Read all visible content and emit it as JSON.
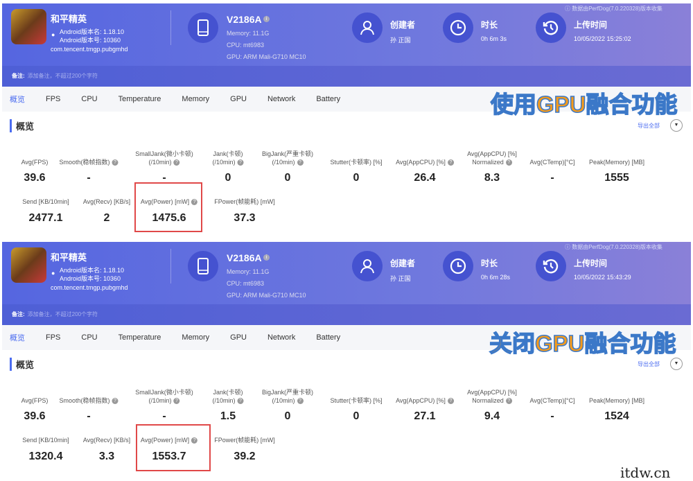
{
  "panels": [
    {
      "app": {
        "name": "和平精英",
        "version_name": "Android版本名: 1.18.10",
        "version_code": "Android版本号: 10360",
        "package": "com.tencent.tmgp.pubgmhd"
      },
      "device": {
        "model": "V2186A",
        "memory": "Memory: 11.1G",
        "cpu": "CPU: mt6983",
        "gpu": "GPU: ARM Mali-G710 MC10"
      },
      "creator": {
        "label": "创建者",
        "value": "孙 正国"
      },
      "duration": {
        "label": "时长",
        "value": "0h 6m 3s"
      },
      "upload": {
        "label": "上传时间",
        "value": "10/05/2022 15:25:02"
      },
      "source_note": "ⓘ 数据由PerfDog(7.0.220328)版本收集",
      "remark": {
        "label": "备注:",
        "placeholder": "添加备注，不超过200个字符"
      },
      "tabs": [
        "概览",
        "FPS",
        "CPU",
        "Temperature",
        "Memory",
        "GPU",
        "Network",
        "Battery"
      ],
      "section_title": "概览",
      "export_label": "导出全部",
      "overlay_caption": "使用GPU融合功能",
      "metrics_row1": [
        {
          "label": "Avg(FPS)",
          "value": "39.6"
        },
        {
          "label": "Smooth(稳帧指数)",
          "value": "-",
          "help": true
        },
        {
          "label": "SmallJank(微小卡顿)\n(/10min)",
          "value": "-",
          "help": true
        },
        {
          "label": "Jank(卡顿)\n(/10min)",
          "value": "0",
          "help": true
        },
        {
          "label": "BigJank(严重卡顿)\n(/10min)",
          "value": "0",
          "help": true
        },
        {
          "label": "Stutter(卡顿率) [%]",
          "value": "0"
        },
        {
          "label": "Avg(AppCPU) [%]",
          "value": "26.4",
          "help": true
        },
        {
          "label": "Avg(AppCPU) [%]\nNormalized",
          "value": "8.3",
          "help": true
        },
        {
          "label": "Avg(CTemp)[°C]",
          "value": "-"
        },
        {
          "label": "Peak(Memory) [MB]",
          "value": "1555"
        }
      ],
      "metrics_row2": [
        {
          "label": "Send [KB/10min]",
          "value": "2477.1"
        },
        {
          "label": "Avg(Recv) [KB/s]",
          "value": "2"
        },
        {
          "label": "Avg(Power) [mW]",
          "value": "1475.6",
          "help": true,
          "highlighted": true
        },
        {
          "label": "FPower(帧能耗) [mW]",
          "value": "37.3"
        }
      ]
    },
    {
      "app": {
        "name": "和平精英",
        "version_name": "Android版本名: 1.18.10",
        "version_code": "Android版本号: 10360",
        "package": "com.tencent.tmgp.pubgmhd"
      },
      "device": {
        "model": "V2186A",
        "memory": "Memory: 11.1G",
        "cpu": "CPU: mt6983",
        "gpu": "GPU: ARM Mali-G710 MC10"
      },
      "creator": {
        "label": "创建者",
        "value": "孙 正国"
      },
      "duration": {
        "label": "时长",
        "value": "0h 6m 28s"
      },
      "upload": {
        "label": "上传时间",
        "value": "10/05/2022 15:43:29"
      },
      "source_note": "ⓘ 数据由PerfDog(7.0.220328)版本收集",
      "remark": {
        "label": "备注:",
        "placeholder": "添加备注，不超过200个字符"
      },
      "tabs": [
        "概览",
        "FPS",
        "CPU",
        "Temperature",
        "Memory",
        "GPU",
        "Network",
        "Battery"
      ],
      "section_title": "概览",
      "export_label": "导出全部",
      "overlay_caption": "关闭GPU融合功能",
      "metrics_row1": [
        {
          "label": "Avg(FPS)",
          "value": "39.6"
        },
        {
          "label": "Smooth(稳帧指数)",
          "value": "-",
          "help": true
        },
        {
          "label": "SmallJank(微小卡顿)\n(/10min)",
          "value": "-",
          "help": true
        },
        {
          "label": "Jank(卡顿)\n(/10min)",
          "value": "1.5",
          "help": true
        },
        {
          "label": "BigJank(严重卡顿)\n(/10min)",
          "value": "0",
          "help": true
        },
        {
          "label": "Stutter(卡顿率) [%]",
          "value": "0"
        },
        {
          "label": "Avg(AppCPU) [%]",
          "value": "27.1",
          "help": true
        },
        {
          "label": "Avg(AppCPU) [%]\nNormalized",
          "value": "9.4",
          "help": true
        },
        {
          "label": "Avg(CTemp)[°C]",
          "value": "-"
        },
        {
          "label": "Peak(Memory) [MB]",
          "value": "1524"
        }
      ],
      "metrics_row2": [
        {
          "label": "Send [KB/10min]",
          "value": "1320.4"
        },
        {
          "label": "Avg(Recv) [KB/s]",
          "value": "3.3"
        },
        {
          "label": "Avg(Power) [mW]",
          "value": "1553.7",
          "help": true,
          "highlighted": true
        },
        {
          "label": "FPower(帧能耗) [mW]",
          "value": "39.2"
        }
      ]
    }
  ],
  "watermark": "itdw.cn",
  "colors": {
    "accent": "#4b6cf0",
    "header": "#5566e0",
    "highlight_box": "#e04848",
    "caption": "#f39a1c"
  }
}
